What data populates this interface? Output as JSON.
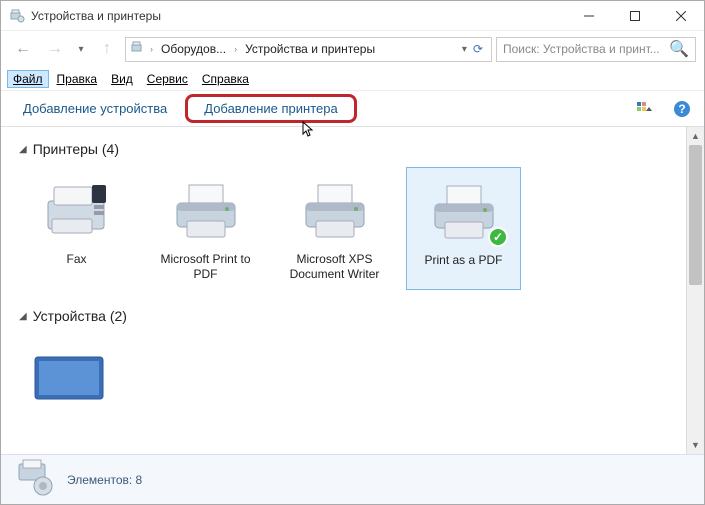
{
  "window": {
    "title": "Устройства и принтеры"
  },
  "nav": {
    "crumb1": "Оборудов...",
    "crumb2": "Устройства и принтеры"
  },
  "search": {
    "placeholder": "Поиск: Устройства и принт..."
  },
  "menu": {
    "file": "Файл",
    "edit": "Правка",
    "view": "Вид",
    "tools": "Сервис",
    "help": "Справка"
  },
  "toolbar": {
    "add_device": "Добавление устройства",
    "add_printer": "Добавление принтера"
  },
  "groups": {
    "printers": {
      "label": "Принтеры (4)"
    },
    "devices": {
      "label": "Устройства (2)"
    }
  },
  "printers": [
    {
      "label": "Fax"
    },
    {
      "label": "Microsoft Print to PDF"
    },
    {
      "label": "Microsoft XPS Document Writer"
    },
    {
      "label": "Print as a PDF"
    }
  ],
  "status": {
    "count_label": "Элементов: 8"
  }
}
